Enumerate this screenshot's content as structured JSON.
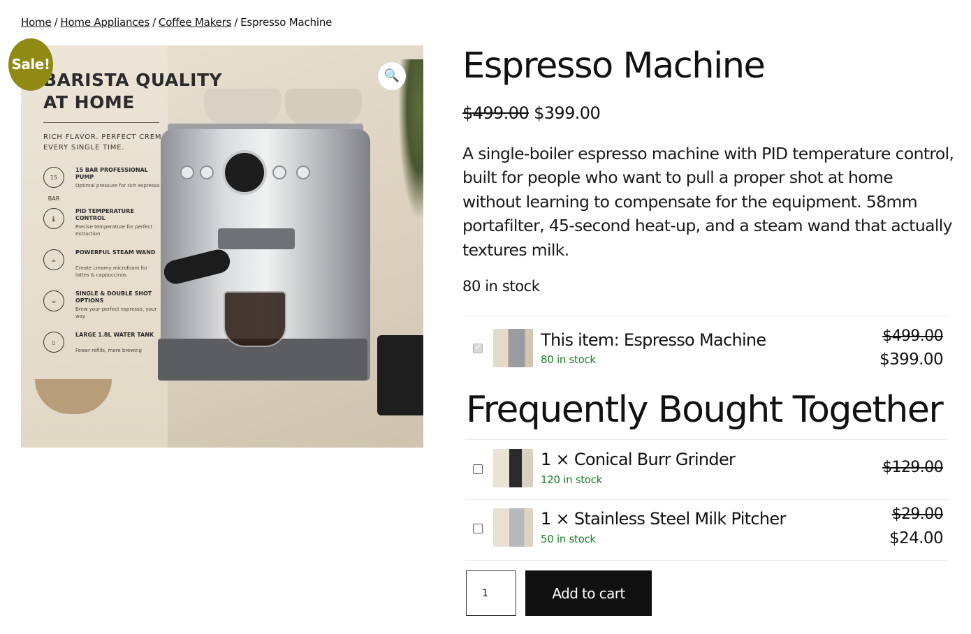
{
  "breadcrumb": {
    "items": [
      "Home",
      "Home Appliances",
      "Coffee Makers"
    ],
    "separator": "/",
    "current": "Espresso Machine"
  },
  "gallery": {
    "sale_badge": "Sale!",
    "zoom_icon": "search-icon",
    "image_text": {
      "headline_1": "BARISTA QUALITY",
      "headline_2": "AT HOME",
      "tagline_1": "RICH FLAVOR. PERFECT CREMA.",
      "tagline_2": "EVERY SINGLE TIME.",
      "features": [
        {
          "badge": "15 BAR",
          "title": "15 BAR PROFESSIONAL PUMP",
          "desc": "Optimal pressure for rich espresso"
        },
        {
          "badge": "🌡",
          "title": "PID TEMPERATURE CONTROL",
          "desc": "Precise temperature for perfect extraction"
        },
        {
          "badge": "☕",
          "title": "POWERFUL STEAM WAND",
          "desc": "Create creamy microfoam for lattes & cappuccinos"
        },
        {
          "badge": "☕",
          "title": "SINGLE & DOUBLE SHOT OPTIONS",
          "desc": "Brew your perfect espresso, your way"
        },
        {
          "badge": "▯",
          "title": "LARGE 1.8L WATER TANK",
          "desc": "Fewer refills, more brewing"
        }
      ]
    }
  },
  "product": {
    "title": "Espresso Machine",
    "price_old": "$499.00",
    "price_new": "$399.00",
    "description": "A single-boiler espresso machine with PID temperature control, built for people who want to pull a proper shot at home without learning to compensate for the equipment. 58mm portafilter, 45-second heat-up, and a steam wand that actually textures milk.",
    "stock": "80 in stock"
  },
  "fbt": {
    "heading": "Frequently Bought Together",
    "main_item": {
      "name": "This item: Espresso Machine",
      "stock": "80 in stock",
      "price_old": "$499.00",
      "price_new": "$399.00",
      "checked": true
    },
    "items": [
      {
        "name": "1 × Conical Burr Grinder",
        "stock": "120 in stock",
        "price_old": "$129.00",
        "price_new": "",
        "checked": false
      },
      {
        "name": "1 × Stainless Steel Milk Pitcher",
        "stock": "50 in stock",
        "price_old": "$29.00",
        "price_new": "$24.00",
        "checked": false
      }
    ]
  },
  "cart": {
    "quantity": "1",
    "add_button": "Add to cart"
  },
  "colors": {
    "sale_badge": "#8f8a13",
    "stock_green": "#1d7d2a",
    "button_bg": "#111111"
  }
}
